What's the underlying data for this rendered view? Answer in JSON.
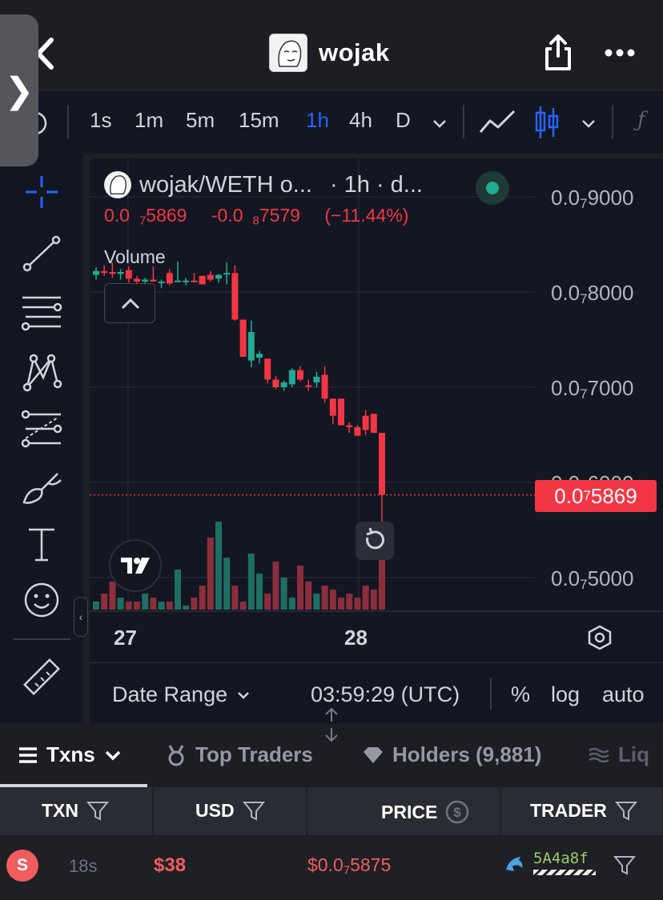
{
  "header": {
    "title": "wojak",
    "back_icon": "chevron-left-icon",
    "share_icon": "share-icon",
    "more_icon": "more-horizontal-icon"
  },
  "toolbar": {
    "intervals": [
      "1s",
      "1m",
      "5m",
      "15m",
      "1h",
      "4h",
      "D"
    ],
    "active_interval": "1h",
    "chart_styles": [
      "line-chart-icon",
      "candlestick-icon"
    ],
    "indicator_icon": "function-icon"
  },
  "left_tools": [
    "crosshair-icon",
    "trend-line-icon",
    "horizontal-lines-icon",
    "pattern-icon",
    "fib-icon",
    "brush-icon",
    "text-icon",
    "emoji-icon",
    "ruler-icon"
  ],
  "chart": {
    "symbol": "wojak/WETH o...",
    "interval_label": "· 1h · d...",
    "legend": {
      "price_pre": "0.0",
      "price_zeros": "7",
      "price_post": "5869",
      "change_pre": "-0.0",
      "change_zeros": "8",
      "change_post": "7579",
      "change_pct": "(−11.44%)"
    },
    "volume_label": "Volume",
    "current_price": {
      "pre": "0.0",
      "zeros": "7",
      "post": "5869"
    },
    "date_labels": [
      "27",
      "28"
    ],
    "bottom_bar": {
      "date_range": "Date Range",
      "time": "03:59:29 (UTC)",
      "percent": "%",
      "log": "log",
      "auto": "auto"
    },
    "colors": {
      "up": "#22ab94",
      "down": "#f23645",
      "accent": "#2962ff"
    }
  },
  "chart_data": {
    "type": "candlestick",
    "y_axis": {
      "tick_labels": [
        {
          "pre": "0.0",
          "zeros": "7",
          "post": "9000"
        },
        {
          "pre": "0.0",
          "zeros": "7",
          "post": "8000"
        },
        {
          "pre": "0.0",
          "zeros": "7",
          "post": "7000"
        },
        {
          "pre": "0.0",
          "zeros": "7",
          "post": "6000"
        },
        {
          "pre": "0.0",
          "zeros": "7",
          "post": "5000"
        }
      ],
      "range": [
        4.51e-08,
        9.36e-08
      ]
    },
    "x_ticks": [
      "27",
      "28"
    ],
    "candles": [
      [
        8.18e-08,
        8.26e-08,
        8.13e-08,
        8.22e-08
      ],
      [
        8.22e-08,
        8.28e-08,
        8.17e-08,
        8.2e-08
      ],
      [
        8.21e-08,
        8.31e-08,
        8.15e-08,
        8.19e-08
      ],
      [
        8.19e-08,
        8.24e-08,
        8.13e-08,
        8.21e-08
      ],
      [
        8.23e-08,
        8.27e-08,
        8.1e-08,
        8.14e-08
      ],
      [
        8.14e-08,
        8.17e-08,
        8.09e-08,
        8.11e-08
      ],
      [
        8.11e-08,
        8.15e-08,
        8.08e-08,
        8.13e-08
      ],
      [
        8.13e-08,
        8.27e-08,
        8.11e-08,
        8.11e-08
      ],
      [
        8.1e-08,
        8.13e-08,
        8.04e-08,
        8.11e-08
      ],
      [
        8.2e-08,
        8.24e-08,
        8.07e-08,
        8.09e-08
      ],
      [
        8.12e-08,
        8.32e-08,
        8.12e-08,
        8.12e-08
      ],
      [
        8.11e-08,
        8.15e-08,
        8.07e-08,
        8.12e-08
      ],
      [
        8.12e-08,
        8.2e-08,
        8.1e-08,
        8.11e-08
      ],
      [
        8.17e-08,
        8.17e-08,
        8.08e-08,
        8.08e-08
      ],
      [
        8.18e-08,
        8.22e-08,
        8.11e-08,
        8.13e-08
      ],
      [
        8.14e-08,
        8.19e-08,
        8.1e-08,
        8.18e-08
      ],
      [
        8.2e-08,
        8.31e-08,
        8.08e-08,
        8.2e-08
      ],
      [
        8.2e-08,
        8.28e-08,
        7.7e-08,
        7.71e-08
      ],
      [
        7.71e-08,
        7.64e-08,
        7.7e-08,
        7.32e-08
      ],
      [
        7.28e-08,
        7.7e-08,
        7.21e-08,
        7.58e-08
      ],
      [
        7.31e-08,
        7.38e-08,
        7.25e-08,
        7.35e-08
      ],
      [
        7.3e-08,
        7.29e-08,
        7.04e-08,
        7.08e-08
      ],
      [
        7.08e-08,
        7.12e-08,
        6.98e-08,
        7e-08
      ],
      [
        7e-08,
        7.07e-08,
        6.96e-08,
        7.05e-08
      ],
      [
        7.03e-08,
        7.2e-08,
        7e-08,
        7.18e-08
      ],
      [
        7.18e-08,
        7.22e-08,
        7.06e-08,
        7.08e-08
      ],
      [
        7.02e-08,
        7.08e-08,
        6.96e-08,
        7.01e-08
      ],
      [
        7.05e-08,
        7.16e-08,
        7e-08,
        7.11e-08
      ],
      [
        7.13e-08,
        7.22e-08,
        6.84e-08,
        6.88e-08
      ],
      [
        6.88e-08,
        6.85e-08,
        6.61e-08,
        6.7e-08
      ],
      [
        6.88e-08,
        6.85e-08,
        6.61e-08,
        6.6e-08
      ],
      [
        6.6e-08,
        6.63e-08,
        6.52e-08,
        6.58e-08
      ],
      [
        6.58e-08,
        6.6e-08,
        6.5e-08,
        6.49e-08
      ],
      [
        6.7e-08,
        6.76e-08,
        6.5e-08,
        6.55e-08
      ],
      [
        6.72e-08,
        6.72e-08,
        6.72e-08,
        6.52e-08
      ],
      [
        6.52e-08,
        6.52e-08,
        5.55e-08,
        5.87e-08
      ]
    ],
    "volumes": [
      2,
      4,
      7,
      3,
      2,
      2,
      4,
      3,
      2,
      2,
      10,
      1,
      3,
      6,
      18,
      22,
      13,
      6,
      2,
      14,
      9,
      4,
      12,
      8,
      3,
      11,
      7,
      4,
      6,
      5,
      3,
      4,
      3,
      6,
      5,
      19
    ],
    "last_price": 5.869e-08
  },
  "tabs": [
    {
      "label": "Txns",
      "icon": "list-icon",
      "extra": "chevron-down-icon"
    },
    {
      "label": "Top Traders",
      "icon": "medal-icon"
    },
    {
      "label": "Holders (9,881)",
      "icon": "diamond-icon"
    },
    {
      "label": "Liq",
      "icon": "liquidity-icon"
    }
  ],
  "table": {
    "headers": [
      {
        "label": "TXN",
        "icon": "filter-icon"
      },
      {
        "label": "USD",
        "icon": "filter-icon"
      },
      {
        "label": "PRICE",
        "icon": "dollar-circle-icon"
      },
      {
        "label": "TRADER",
        "icon": "filter-icon"
      }
    ],
    "rows": [
      {
        "side": "S",
        "age": "18s",
        "usd": "$38",
        "price_pre": "$0.0",
        "price_zeros": "7",
        "price_post": "5875",
        "trader": "5A4a8f"
      }
    ]
  }
}
